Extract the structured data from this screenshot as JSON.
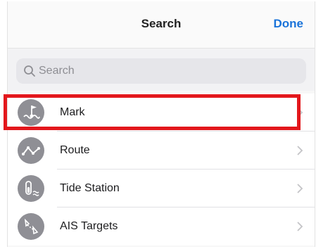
{
  "navbar": {
    "title": "Search",
    "done_label": "Done"
  },
  "search": {
    "placeholder": "Search",
    "value": ""
  },
  "list": {
    "items": [
      {
        "label": "Mark",
        "icon": "mark-icon",
        "selected": true
      },
      {
        "label": "Route",
        "icon": "route-icon",
        "selected": false
      },
      {
        "label": "Tide Station",
        "icon": "tide-station-icon",
        "selected": false
      },
      {
        "label": "AIS Targets",
        "icon": "ais-targets-icon",
        "selected": false
      }
    ]
  },
  "colors": {
    "accent": "#1a73d9",
    "highlight": "#e3171c",
    "icon_bg": "#8f8f95"
  }
}
